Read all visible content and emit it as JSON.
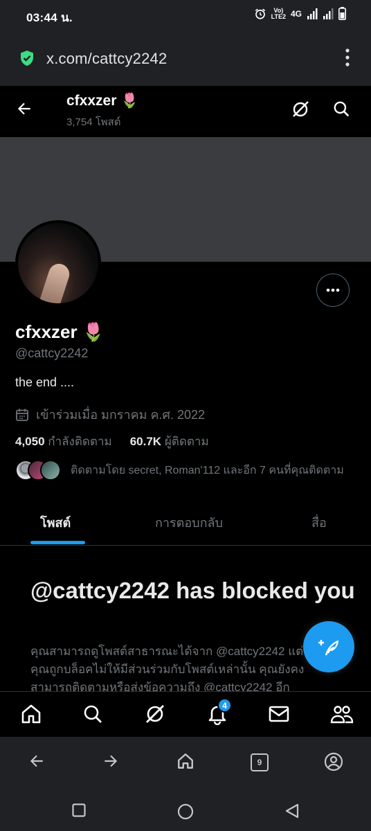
{
  "status_bar": {
    "time": "03:44 น.",
    "volte": "Vo)",
    "lte": "LTE2",
    "network": "4G"
  },
  "browser": {
    "url": "x.com/cattcy2242",
    "tab_count": "9"
  },
  "header": {
    "name": "cfxxzer 🌷",
    "post_count": "3,754 โพสต์"
  },
  "profile": {
    "display_name": "cfxxzer 🌷",
    "handle": "@cattcy2242",
    "bio": "the end ....",
    "joined": "เข้าร่วมเมื่อ มกราคม ค.ศ. 2022",
    "following_count": "4,050",
    "following_label": "กำลังติดตาม",
    "followers_count": "60.7K",
    "followers_label": "ผู้ติดตาม",
    "followed_by": "ติดตามโดย secret, Roman'112 และอีก 7 คนที่คุณติดตาม"
  },
  "tabs": [
    {
      "label": "โพสต์",
      "active": true
    },
    {
      "label": "การตอบกลับ",
      "active": false
    },
    {
      "label": "สื่อ",
      "active": false
    }
  ],
  "blocked": {
    "title": "@cattcy2242 has blocked you",
    "body": "คุณสามารถดูโพสต์สาธารณะได้จาก @cattcy2242 แต่คุณถูกบล็อคไม่ให้มีส่วนร่วมกับโพสต์เหล่านั้น คุณยังคงสามารถติดตามหรือส่งข้อความถึง @cattcy2242 อีก"
  },
  "bottom_nav": {
    "items": [
      "home-icon",
      "search-icon",
      "grok-icon",
      "notifications-icon",
      "messages-icon",
      "communities-icon"
    ],
    "notification_badge": "4"
  },
  "colors": {
    "accent": "#1d9bf0",
    "background": "#000000",
    "secondary_text": "#71767b",
    "shield": "#3ddc84"
  }
}
